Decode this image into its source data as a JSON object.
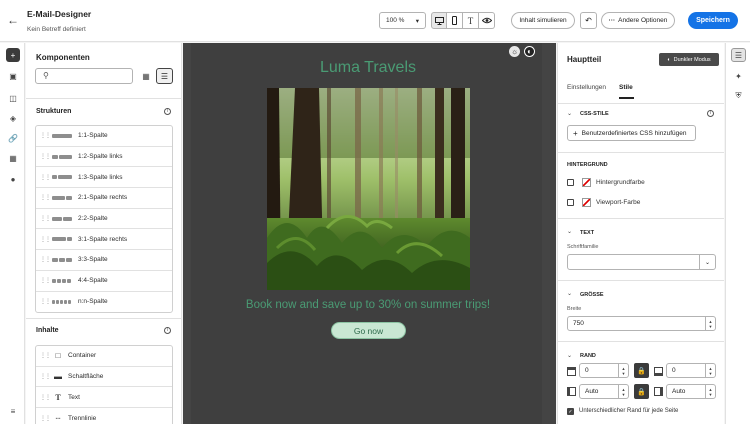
{
  "header": {
    "title": "E-Mail-Designer",
    "subtitle": "Kein Betreff definiert",
    "zoom": "100 %",
    "simulate_label": "Inhalt simulieren",
    "more_label": "Andere Optionen",
    "save_label": "Speichern"
  },
  "left_panel": {
    "title": "Komponenten",
    "structures_heading": "Strukturen",
    "structures": [
      "1:1-Spalte",
      "1:2-Spalte links",
      "1:3-Spalte links",
      "2:1-Spalte rechts",
      "2:2-Spalte",
      "3:1-Spalte rechts",
      "3:3-Spalte",
      "4:4-Spalte",
      "n:n-Spalte"
    ],
    "content_heading": "Inhalte",
    "content": [
      "Container",
      "Schaltfläche",
      "Text",
      "Trennlinie"
    ]
  },
  "canvas": {
    "brand": "Luma Travels",
    "tagline": "Book now and save up to 30% on summer trips!",
    "cta": "Go now"
  },
  "right_panel": {
    "title": "Hauptteil",
    "dark_mode": "Dunkler Modus",
    "tabs": [
      "Einstellungen",
      "Stile"
    ],
    "css_heading": "CSS-STILE",
    "css_button": "Benutzerdefiniertes CSS hinzufügen",
    "background_heading": "HINTERGRUND",
    "bg_color": "Hintergrundfarbe",
    "viewport_color": "Viewport-Farbe",
    "text_heading": "TEXT",
    "font_family_label": "Schriftfamilie",
    "size_heading": "GRÖSSE",
    "width_label": "Breite",
    "width_value": "750",
    "border_heading": "RAND",
    "border_top": "0",
    "border_bottom": "0",
    "border_left": "Auto",
    "border_right": "Auto",
    "different_border": "Unterschiedlicher Rand für jede Seite"
  },
  "colors": {
    "accent": "#1473e6",
    "brand_text": "#4a9b74",
    "cta_bg": "#c9e7d3",
    "canvas_bg": "#444444"
  }
}
